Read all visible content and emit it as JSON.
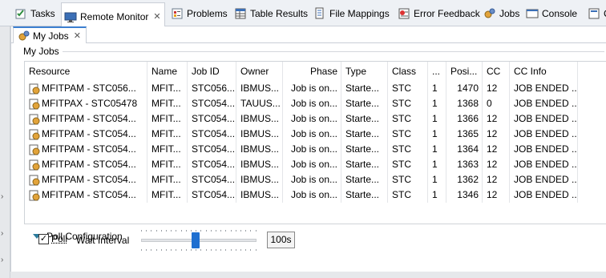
{
  "view_tabs": [
    {
      "label": "Tasks",
      "icon": "tasks-icon"
    },
    {
      "label": "Remote Monitor",
      "icon": "remote-monitor-icon"
    },
    {
      "label": "Problems",
      "icon": "problems-icon"
    },
    {
      "label": "Table Results",
      "icon": "table-results-icon"
    },
    {
      "label": "File Mappings",
      "icon": "file-mappings-icon"
    },
    {
      "label": "Error Feedback",
      "icon": "error-feedback-icon"
    },
    {
      "label": "Jobs",
      "icon": "jobs-icon"
    },
    {
      "label": "Console",
      "icon": "console-icon"
    },
    {
      "label": "C",
      "icon": "extra-view-icon"
    }
  ],
  "inner_tab": {
    "label": "My Jobs"
  },
  "group": {
    "label": "My Jobs"
  },
  "table": {
    "columns": [
      "Resource",
      "Name",
      "Job ID",
      "Owner",
      "Phase",
      "Type",
      "Class",
      "...",
      "Posi...",
      "CC",
      "CC Info"
    ],
    "rows": [
      [
        "MFITPAM - STC056...",
        "MFIT...",
        "STC056...",
        "IBMUS...",
        "Job is on...",
        "Starte...",
        "STC",
        "1",
        "1470",
        "12",
        "JOB ENDED ..."
      ],
      [
        "MFITPAX - STC05478",
        "MFIT...",
        "STC054...",
        "TAUUS...",
        "Job is on...",
        "Starte...",
        "STC",
        "1",
        "1368",
        "0",
        "JOB ENDED ..."
      ],
      [
        "MFITPAM - STC054...",
        "MFIT...",
        "STC054...",
        "IBMUS...",
        "Job is on...",
        "Starte...",
        "STC",
        "1",
        "1366",
        "12",
        "JOB ENDED ..."
      ],
      [
        "MFITPAM - STC054...",
        "MFIT...",
        "STC054...",
        "IBMUS...",
        "Job is on...",
        "Starte...",
        "STC",
        "1",
        "1365",
        "12",
        "JOB ENDED ..."
      ],
      [
        "MFITPAM - STC054...",
        "MFIT...",
        "STC054...",
        "IBMUS...",
        "Job is on...",
        "Starte...",
        "STC",
        "1",
        "1364",
        "12",
        "JOB ENDED ..."
      ],
      [
        "MFITPAM - STC054...",
        "MFIT...",
        "STC054...",
        "IBMUS...",
        "Job is on...",
        "Starte...",
        "STC",
        "1",
        "1363",
        "12",
        "JOB ENDED ..."
      ],
      [
        "MFITPAM - STC054...",
        "MFIT...",
        "STC054...",
        "IBMUS...",
        "Job is on...",
        "Starte...",
        "STC",
        "1",
        "1362",
        "12",
        "JOB ENDED ..."
      ],
      [
        "MFITPAM - STC054...",
        "MFIT...",
        "STC054...",
        "IBMUS...",
        "Job is on...",
        "Starte...",
        "STC",
        "1",
        "1346",
        "12",
        "JOB ENDED ..."
      ]
    ]
  },
  "poll": {
    "section_label": "Poll Configuration",
    "checkbox_label": "Poll",
    "checked": true,
    "wait_label": "Wait Interval",
    "interval_value": "100s",
    "slider_fraction": 0.47
  },
  "colors": {
    "accent": "#1f6fd0",
    "section_triangle": "#2b7a9b"
  }
}
